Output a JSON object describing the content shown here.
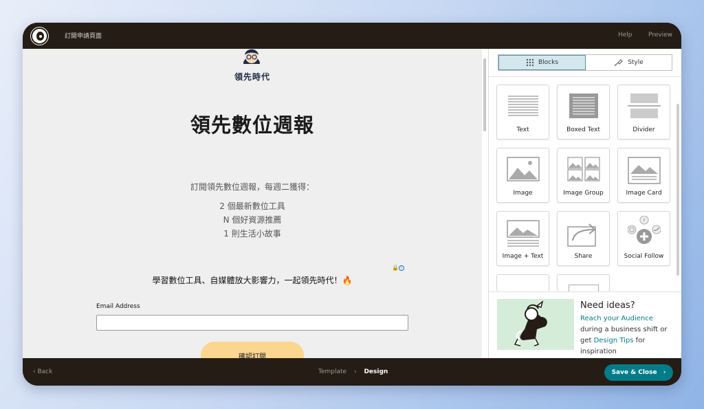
{
  "topbar": {
    "title": "訂閱申請頁面",
    "help": "Help",
    "preview": "Preview"
  },
  "form": {
    "brand": "領先時代",
    "title": "領先數位週報",
    "intro": "訂閱領先數位週報，每週二獲得：",
    "items": [
      "2 個最新數位工具",
      "N 個好資源推薦",
      "1 則生活小故事"
    ],
    "tagline": "學習數位工具、自媒體放大影響力，一起領先時代！🔥",
    "email_label": "Email Address",
    "email_value": "",
    "submit_label": "確認訂閱"
  },
  "panel": {
    "tabs": [
      {
        "label": "Blocks",
        "icon": "grid-icon",
        "active": true
      },
      {
        "label": "Style",
        "icon": "paint-brush-icon",
        "active": false
      }
    ],
    "blocks": [
      {
        "label": "Text",
        "icon": "text-block-icon"
      },
      {
        "label": "Boxed Text",
        "icon": "boxed-text-icon"
      },
      {
        "label": "Divider",
        "icon": "divider-icon"
      },
      {
        "label": "Image",
        "icon": "image-icon"
      },
      {
        "label": "Image Group",
        "icon": "image-group-icon"
      },
      {
        "label": "Image Card",
        "icon": "image-card-icon"
      },
      {
        "label": "Image + Text",
        "icon": "image-text-icon"
      },
      {
        "label": "Share",
        "icon": "share-icon"
      },
      {
        "label": "Social Follow",
        "icon": "social-follow-icon"
      }
    ],
    "ideas": {
      "heading": "Need ideas?",
      "link1": "Reach your Audience",
      "text1": " during a business shift or get ",
      "link2": "Design Tips",
      "text2": " for inspiration"
    }
  },
  "bottombar": {
    "back": "‹ Back",
    "steps": [
      "Template",
      "Design"
    ],
    "current_step": "Design",
    "save": "Save & Close"
  },
  "colors": {
    "chrome": "#241c15",
    "accent": "#007c89",
    "submit": "#fbd68e",
    "active_tab": "#d3e8ee"
  }
}
